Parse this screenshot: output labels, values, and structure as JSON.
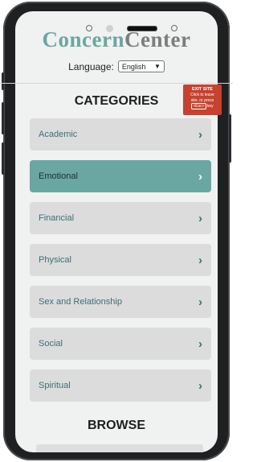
{
  "logo": {
    "part1": "Concern",
    "part2": "Center"
  },
  "language": {
    "label": "Language:",
    "selected": "English",
    "arrow": "▼"
  },
  "exit_site": {
    "title": "EXIT SITE",
    "line1": "Click to leave",
    "line2": "site, or press",
    "key": "<Esc>",
    "line3": " key"
  },
  "categories": {
    "title": "CATEGORIES",
    "items": [
      {
        "label": "Academic",
        "chevron": "›"
      },
      {
        "label": "Emotional",
        "chevron": "›"
      },
      {
        "label": "Financial",
        "chevron": "›"
      },
      {
        "label": "Physical",
        "chevron": "›"
      },
      {
        "label": "Sex and Relationship",
        "chevron": "›"
      },
      {
        "label": "Social",
        "chevron": "›"
      },
      {
        "label": "Spiritual",
        "chevron": "›"
      }
    ]
  },
  "browse": {
    "title": "BROWSE"
  },
  "colors": {
    "brand_teal": "#6aa7a2",
    "brand_gray": "#7d7d7d",
    "exit_red": "#c6412f",
    "card_gray": "#dcdcdc"
  }
}
